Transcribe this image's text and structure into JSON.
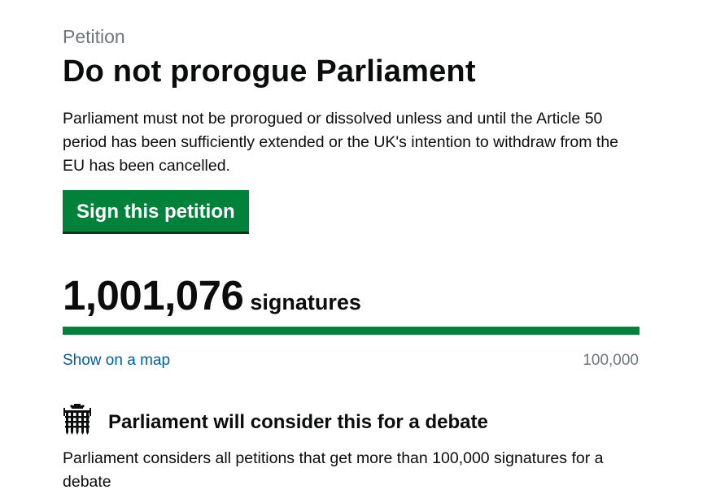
{
  "petition": {
    "caption": "Petition",
    "title": "Do not prorogue Parliament",
    "description": "Parliament must not be prorogued or dissolved unless and until the Article 50 period has been sufficiently extended or the UK's intention to withdraw from the EU has been cancelled.",
    "sign_button_label": "Sign this petition"
  },
  "signatures": {
    "count": "1,001,076",
    "label": "signatures",
    "progress_fraction": 1.0,
    "threshold": "100,000",
    "map_link": "Show on a map"
  },
  "debate": {
    "icon": "portcullis-icon",
    "heading": "Parliament will consider this for a debate",
    "description": "Parliament considers all petitions that get more than 100,000 signatures for a debate"
  },
  "colors": {
    "button_green": "#00823b",
    "progress_green": "#00823b",
    "link_blue": "#005ea5",
    "muted_grey": "#6f777b",
    "text": "#0b0c0c"
  }
}
